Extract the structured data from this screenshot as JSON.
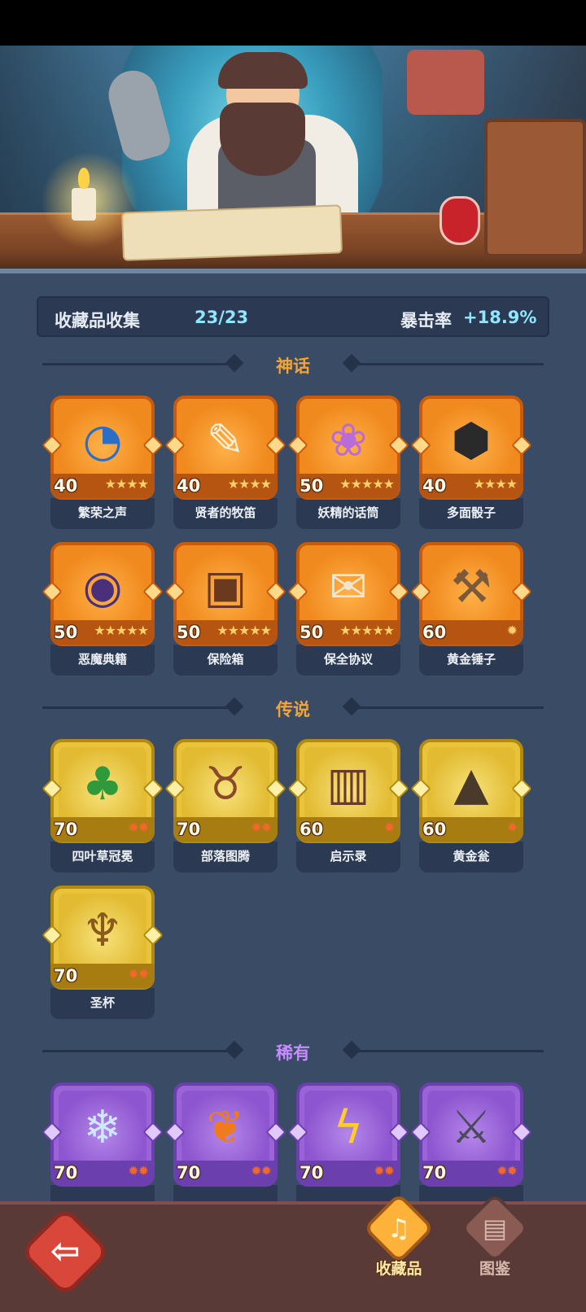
{
  "summary": {
    "collection_label": "收藏品收集",
    "collection_count": "23/23",
    "crit_label": "暴击率",
    "crit_value": "+18.9%"
  },
  "sections": {
    "mythic": {
      "title": "神话",
      "color": "#f0a53a",
      "items": [
        {
          "name": "繁荣之声",
          "level": "40",
          "stars": "★★★★",
          "icon": "shell-icon"
        },
        {
          "name": "贤者的牧笛",
          "level": "40",
          "stars": "★★★★",
          "icon": "flute-icon"
        },
        {
          "name": "妖精的话筒",
          "level": "50",
          "stars": "★★★★★",
          "icon": "fairy-microphone-icon"
        },
        {
          "name": "多面骰子",
          "level": "40",
          "stars": "★★★★",
          "icon": "dice-icon"
        },
        {
          "name": "恶魔典籍",
          "level": "50",
          "stars": "★★★★★",
          "icon": "demon-book-icon"
        },
        {
          "name": "保险箱",
          "level": "50",
          "stars": "★★★★★",
          "icon": "safe-chest-icon"
        },
        {
          "name": "保全协议",
          "level": "50",
          "stars": "★★★★★",
          "icon": "contract-icon"
        },
        {
          "name": "黄金锤子",
          "level": "60",
          "stars": "✹",
          "icon": "hammer-icon"
        }
      ]
    },
    "legend": {
      "title": "传说",
      "color": "#f0a53a",
      "items": [
        {
          "name": "四叶草冠冕",
          "level": "70",
          "stars": "✹✹",
          "icon": "clover-crown-icon"
        },
        {
          "name": "部落图腾",
          "level": "70",
          "stars": "✹✹",
          "icon": "totem-icon"
        },
        {
          "name": "启示录",
          "level": "60",
          "stars": "✹",
          "icon": "open-book-icon"
        },
        {
          "name": "黄金瓮",
          "level": "60",
          "stars": "✹",
          "icon": "urn-icon"
        },
        {
          "name": "圣杯",
          "level": "70",
          "stars": "✹✹",
          "icon": "grail-icon"
        }
      ]
    },
    "rare": {
      "title": "稀有",
      "color": "#c78bff",
      "items": [
        {
          "name": "",
          "level": "70",
          "stars": "✹✹",
          "icon": "ice-dagger-icon"
        },
        {
          "name": "",
          "level": "70",
          "stars": "✹✹",
          "icon": "feather-icon"
        },
        {
          "name": "",
          "level": "70",
          "stars": "✹✹",
          "icon": "lightning-card-icon"
        },
        {
          "name": "",
          "level": "70",
          "stars": "✹✹",
          "icon": "axe-icon"
        }
      ]
    }
  },
  "nav": {
    "back_icon": "back-arrow-icon",
    "tabs": [
      {
        "label": "收藏品",
        "icon": "lyre-icon",
        "active": true
      },
      {
        "label": "图鉴",
        "icon": "book-icon",
        "active": false
      }
    ]
  }
}
